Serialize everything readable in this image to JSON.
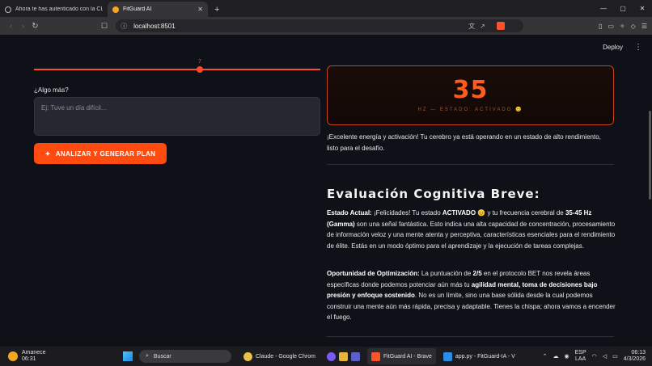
{
  "browser": {
    "tabs": [
      {
        "title": "Ahora te has autenticado con la CLI d",
        "active": false
      },
      {
        "title": "FitGuard AI",
        "active": true
      }
    ],
    "new_tab": "+",
    "url": "localhost:8501",
    "window_controls": [
      "—",
      "▢",
      "✕"
    ]
  },
  "app": {
    "deploy_label": "Deploy",
    "menu_icon": "⋮",
    "slider": {
      "value": "7",
      "fraction": 0.58
    },
    "textarea": {
      "label": "¿Algo más?",
      "placeholder": "Ej: Tuve un día difícil..."
    },
    "analyze_button": "ANALIZAR Y GENERAR PLAN",
    "metric": {
      "value": "35",
      "subtitle": "HZ — ESTADO: ACTIVADO 😊"
    },
    "message": "¡Excelente energía y activación! Tu cerebro ya está operando en un estado de alto rendimiento, listo para el desafío.",
    "evaluation": {
      "title": "Evaluación Cognitiva Breve:",
      "estado_label": "Estado Actual:",
      "estado_p1": " ¡Felicidades! Tu estado ",
      "estado_bold1": "ACTIVADO",
      "estado_p2": " 😊 y tu frecuencia cerebral de ",
      "estado_bold2": "35-45 Hz (Gamma)",
      "estado_p3": " son una señal fantástica. Esto indica una alta capacidad de concentración, procesamiento de información veloz y una mente atenta y perceptiva, características esenciales para el rendimiento de élite. Estás en un modo óptimo para el aprendizaje y la ejecución de tareas complejas.",
      "oport_label": "Oportunidad de Optimización:",
      "oport_p1": " La puntuación de ",
      "oport_bold1": "2/5",
      "oport_p2": " en el protocolo BET nos revela áreas específicas donde podemos potenciar aún más tu ",
      "oport_bold2": "agilidad mental, toma de decisiones bajo presión y enfoque sostenido",
      "oport_p3": ". No es un límite, sino una base sólida desde la cual podemos construir una mente aún más rápida, precisa y adaptable. Tienes la chispa; ahora vamos a encender el fuego."
    }
  },
  "taskbar": {
    "weather_title": "Amanece",
    "weather_time": "06:31",
    "search_placeholder": "Buscar",
    "apps": [
      {
        "label": "Claude - Google Chrom",
        "color": "#e8c04a",
        "active": false
      },
      {
        "label": "FitGuard AI - Brave",
        "color": "#fb542b",
        "active": true
      },
      {
        "label": "app.py - FitGuard-IA - V",
        "color": "#2a8ee6",
        "active": false
      }
    ],
    "lang_top": "ESP",
    "lang_bottom": "LAA",
    "time": "06:13",
    "date": "4/3/2026"
  }
}
